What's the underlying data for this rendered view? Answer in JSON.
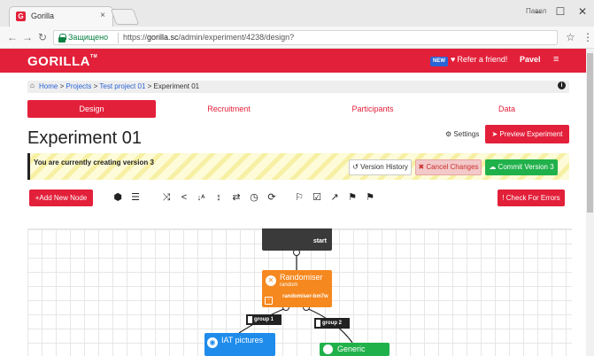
{
  "browser": {
    "tab_title": "Gorilla",
    "tab_close": "×",
    "window_user_label": "Павел",
    "secure_label": "Защищено",
    "url_prefix": "https://",
    "url_host": "gorilla.sc",
    "url_path": "/admin/experiment/4238/design?",
    "icons": [
      "back-icon",
      "forward-icon",
      "reload-icon",
      "lock-icon",
      "star-icon",
      "menu-icon"
    ]
  },
  "header": {
    "logo": "GORILLA",
    "logo_tm": "TM",
    "new_badge": "NEW",
    "refer": "Refer a friend!",
    "user": "Pavel",
    "brand_color": "#e3203a"
  },
  "breadcrumb": {
    "items": [
      "Home",
      "Projects",
      "Test project 01"
    ],
    "current": "Experiment 01",
    "separator": ">"
  },
  "tabs": [
    {
      "label": "Design",
      "active": true
    },
    {
      "label": "Recruitment",
      "active": false
    },
    {
      "label": "Participants",
      "active": false
    },
    {
      "label": "Data",
      "active": false
    }
  ],
  "page": {
    "title": "Experiment 01",
    "settings_label": "Settings",
    "preview_label": "Preview Experiment"
  },
  "version_bar": {
    "message": "You are currently creating version 3",
    "history_label": "Version History",
    "cancel_label": "Cancel Changes",
    "commit_label": "Commit Version 3"
  },
  "toolbar": {
    "add_node_label": "+Add New Node",
    "check_errors_label": "Check For Errors",
    "tools": [
      "cube-icon",
      "list-icon",
      "shuffle-icon",
      "share-icon",
      "sort-alpha-icon",
      "vertical-arrows-icon",
      "exchange-icon",
      "clock-icon",
      "repeat-icon",
      "flag-outline-icon",
      "checkbox-icon",
      "external-link-icon",
      "flag-checkered-icon",
      "flag-icon"
    ]
  },
  "canvas": {
    "start_node": {
      "label": "start"
    },
    "randomiser": {
      "name": "Randomiser",
      "type": "random",
      "id": "randomiser-bm7w"
    },
    "branches": [
      {
        "label": "group 1"
      },
      {
        "label": "group 2"
      }
    ],
    "nodes": [
      {
        "name": "IAT pictures",
        "color": "#1f8ceb"
      },
      {
        "name": "Generic",
        "color": "#21b14b"
      }
    ],
    "randomiser_color": "#f5881f"
  }
}
